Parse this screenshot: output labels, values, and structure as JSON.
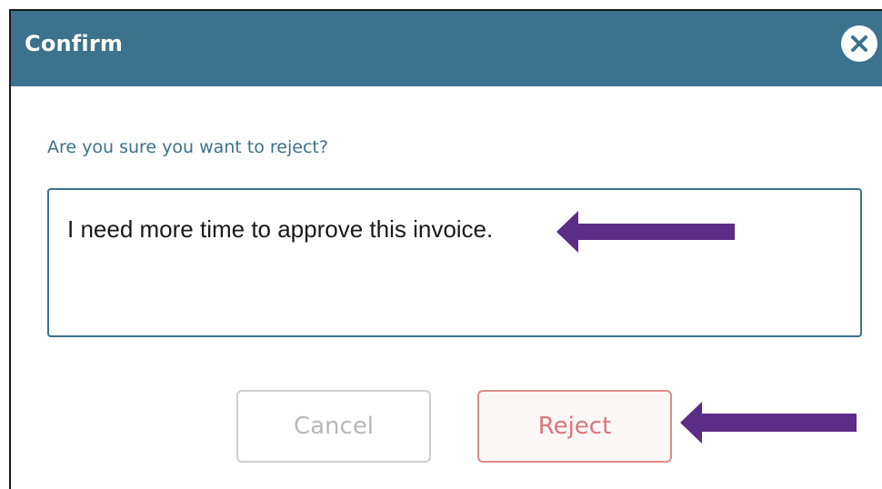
{
  "dialog": {
    "title": "Confirm",
    "close_icon": "close-icon",
    "prompt": "Are you sure you want to reject?",
    "comment_value": "I need more time to approve this invoice.",
    "cancel_label": "Cancel",
    "reject_label": "Reject"
  },
  "annotations": {
    "arrow_icon": "left-arrow-icon",
    "arrow_color": "#5b2d86"
  },
  "colors": {
    "header_bg": "#3b728d",
    "prompt_text": "#3b728d",
    "reject_border": "#e08b8b",
    "reject_text": "#d9777a",
    "cancel_border": "#cfcfcf",
    "cancel_text": "#b8b8b8"
  }
}
